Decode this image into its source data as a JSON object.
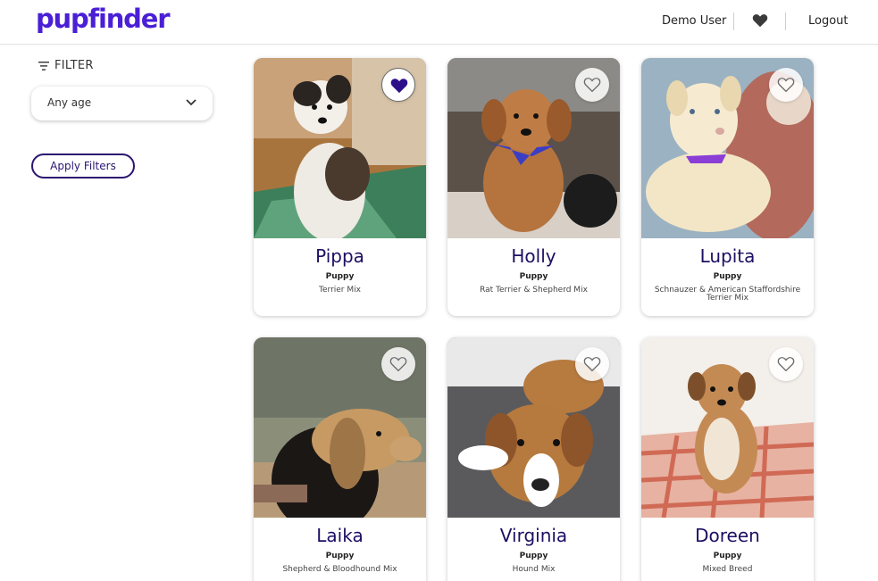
{
  "header": {
    "logo": "pupfinder",
    "user_name": "Demo User",
    "favorites_icon": "heart-icon",
    "logout_label": "Logout",
    "brand_color": "#4a1fd6"
  },
  "sidebar": {
    "filter_icon": "filter-lines-icon",
    "filter_label": "FILTER",
    "age_select": {
      "value": "Any age",
      "icon": "chevron-down-icon"
    },
    "apply_label": "Apply Filters"
  },
  "pets": [
    {
      "name": "Pippa",
      "age": "Puppy",
      "breed": "Terrier Mix",
      "favorited": true
    },
    {
      "name": "Holly",
      "age": "Puppy",
      "breed": "Rat Terrier & Shepherd Mix",
      "favorited": false
    },
    {
      "name": "Lupita",
      "age": "Puppy",
      "breed": "Schnauzer & American Staffordshire Terrier Mix",
      "favorited": false
    },
    {
      "name": "Laika",
      "age": "Puppy",
      "breed": "Shepherd & Bloodhound Mix",
      "favorited": false
    },
    {
      "name": "Virginia",
      "age": "Puppy",
      "breed": "Hound Mix",
      "favorited": false
    },
    {
      "name": "Doreen",
      "age": "Puppy",
      "breed": "Mixed Breed",
      "favorited": false
    }
  ]
}
